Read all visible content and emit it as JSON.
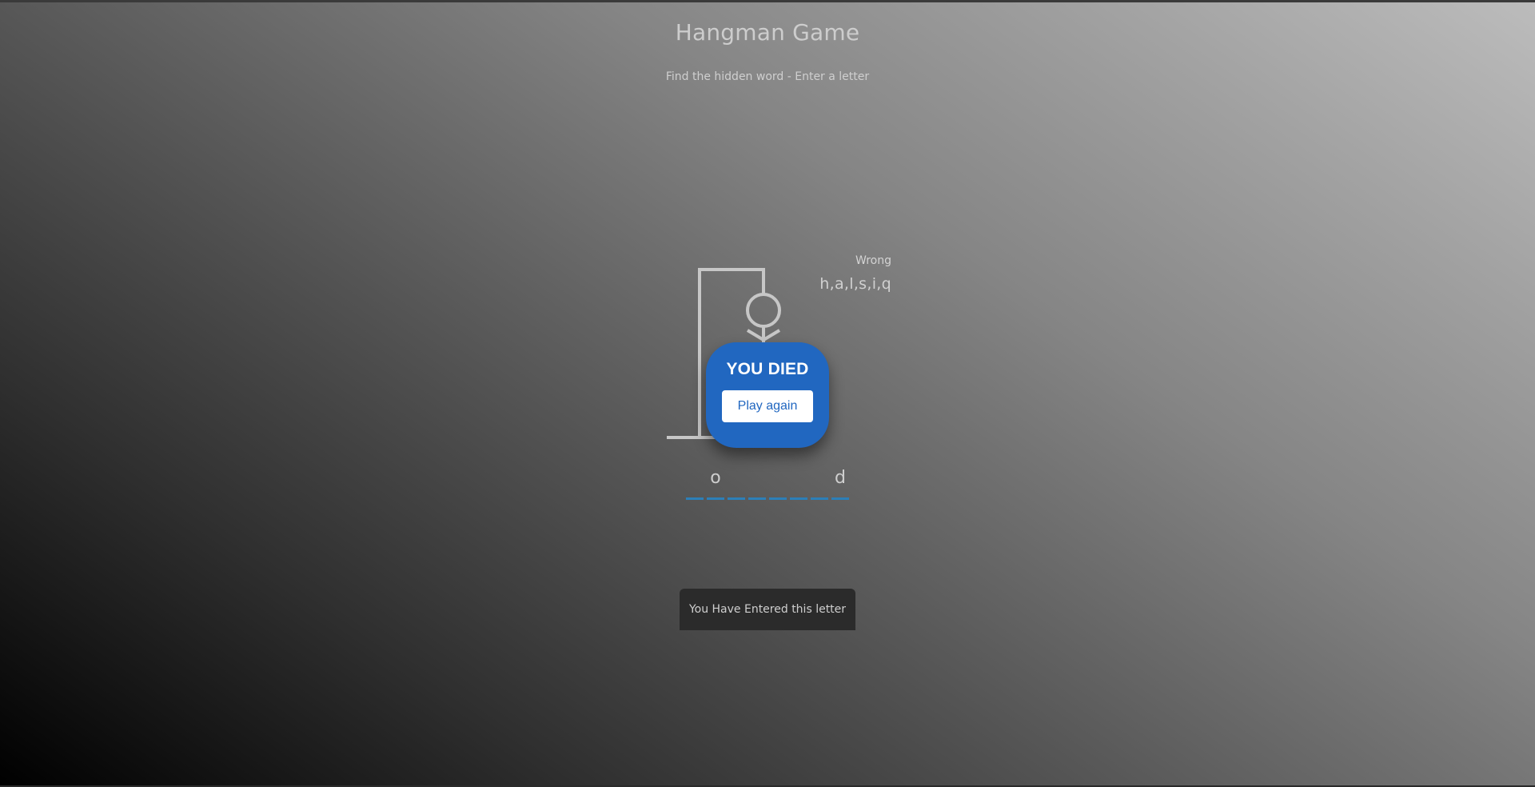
{
  "header": {
    "title": "Hangman Game",
    "subtitle": "Find the hidden word - Enter a letter"
  },
  "wrong": {
    "label": "Wrong",
    "letters": "h,a,l,s,i,q"
  },
  "word": {
    "slots": [
      "",
      "o",
      "",
      "",
      "",
      "",
      "",
      "d"
    ]
  },
  "popup": {
    "title": "YOU DIED",
    "button_label": "Play again",
    "background_color": "#2167c0"
  },
  "notification": {
    "text": "You Have Entered this letter"
  },
  "colors": {
    "underline": "#2c7fb8",
    "figure": "#c7c7c7"
  }
}
